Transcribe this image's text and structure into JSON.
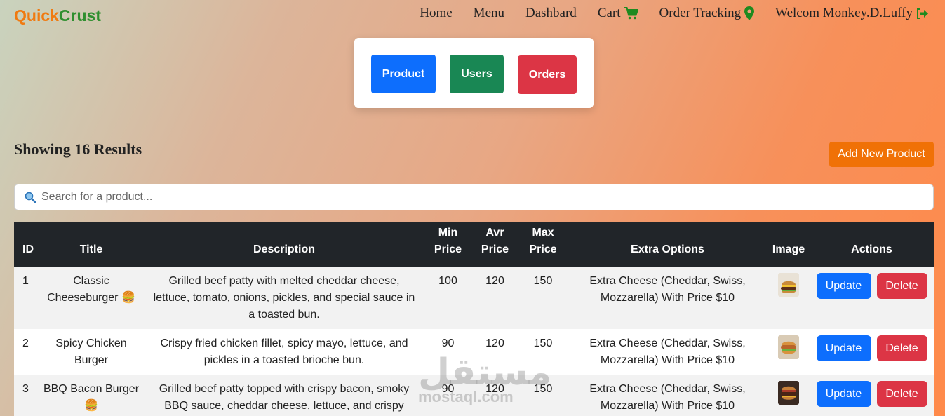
{
  "brand": {
    "part1": "Quick",
    "part2": "Crust"
  },
  "nav": {
    "home": "Home",
    "menu": "Menu",
    "dashboard": "Dashbard",
    "cart": "Cart",
    "order_tracking": "Order Tracking",
    "welcome": "Welcom Monkey.D.Luffy"
  },
  "admin": {
    "product": "Product",
    "users": "Users",
    "orders": "Orders"
  },
  "results": {
    "title": "Showing 16 Results",
    "add_button": "Add New Product"
  },
  "search": {
    "placeholder": "Search for a product..."
  },
  "table": {
    "headers": {
      "id": "ID",
      "title": "Title",
      "description": "Description",
      "min_price_1": "Min",
      "min_price_2": "Price",
      "avr_price_1": "Avr",
      "avr_price_2": "Price",
      "max_price_1": "Max",
      "max_price_2": "Price",
      "extra": "Extra Options",
      "image": "Image",
      "actions": "Actions"
    },
    "rows": [
      {
        "id": "1",
        "title": "Classic Cheeseburger 🍔",
        "description": "Grilled beef patty with melted cheddar cheese, lettuce, tomato, onions, pickles, and special sauce in a toasted bun.",
        "min": "100",
        "avr": "120",
        "max": "150",
        "extra": "Extra Cheese (Cheddar, Swiss, Mozzarella) With Price $10",
        "update": "Update",
        "delete": "Delete"
      },
      {
        "id": "2",
        "title": "Spicy Chicken Burger",
        "description": "Crispy fried chicken fillet, spicy mayo, lettuce, and pickles in a toasted brioche bun.",
        "min": "90",
        "avr": "120",
        "max": "150",
        "extra": "Extra Cheese (Cheddar, Swiss, Mozzarella) With Price $10",
        "update": "Update",
        "delete": "Delete"
      },
      {
        "id": "3",
        "title": "BBQ Bacon Burger 🍔",
        "description": "Grilled beef patty topped with crispy bacon, smoky BBQ sauce, cheddar cheese, lettuce, and crispy",
        "min": "90",
        "avr": "120",
        "max": "150",
        "extra": "Extra Cheese (Cheddar, Swiss, Mozzarella) With Price $10",
        "update": "Update",
        "delete": "Delete"
      }
    ]
  },
  "watermark": {
    "arabic": "مستقل",
    "latin": "mostaql.com"
  },
  "colors": {
    "accent_orange": "#f07106",
    "primary_blue": "#0d6efd",
    "success_green": "#198754",
    "danger_red": "#dc3545",
    "table_head": "#212529"
  }
}
